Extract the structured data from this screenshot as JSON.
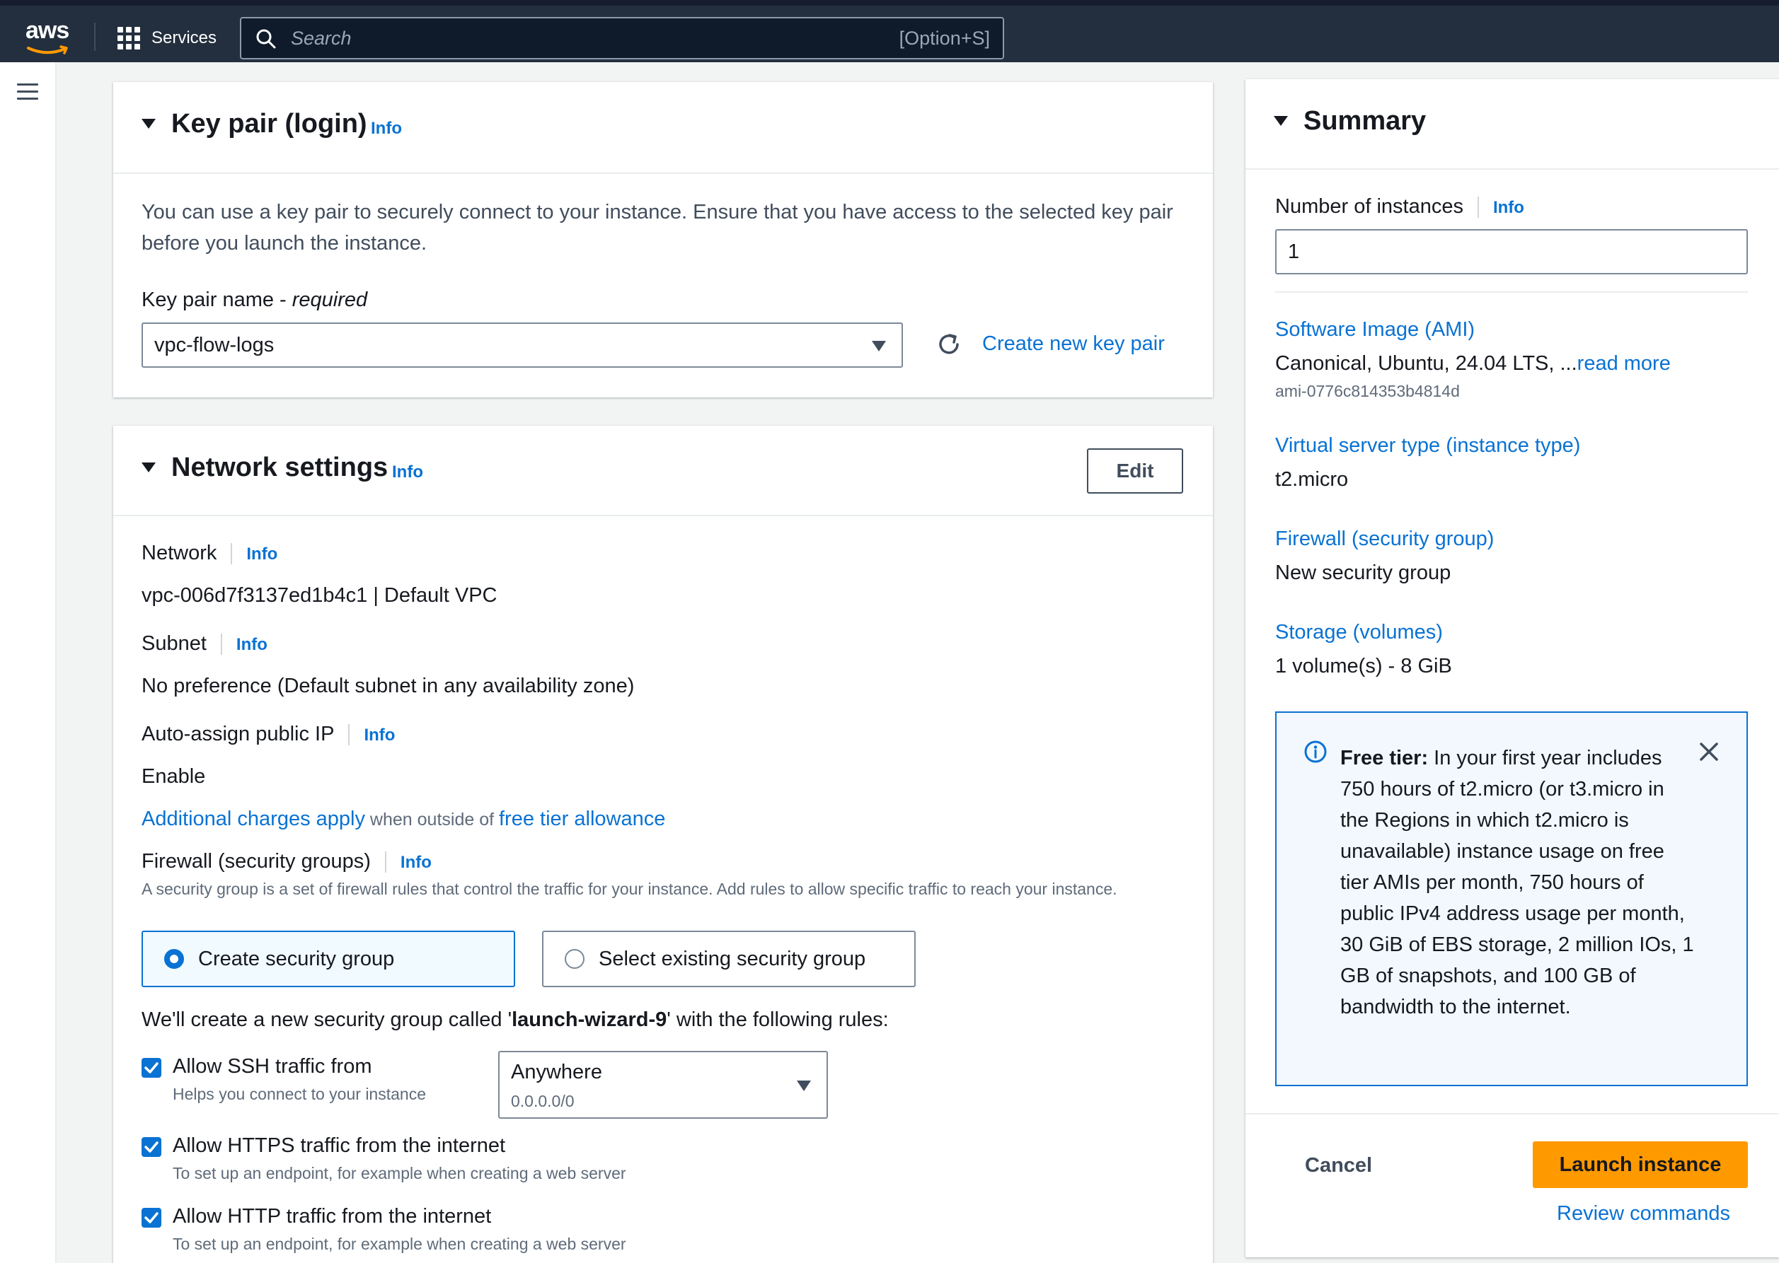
{
  "topbar": {
    "logo_text": "aws",
    "services_label": "Services",
    "search_placeholder": "Search",
    "search_shortcut": "[Option+S]"
  },
  "key_pair": {
    "title": "Key pair (login)",
    "info": "Info",
    "description": "You can use a key pair to securely connect to your instance. Ensure that you have access to the selected key pair before you launch the instance.",
    "field_label": "Key pair name - ",
    "field_required": "required",
    "selected_value": "vpc-flow-logs",
    "create_link": "Create new key pair"
  },
  "network": {
    "title": "Network settings",
    "info": "Info",
    "edit_label": "Edit",
    "network_label": "Network",
    "network_value": "vpc-006d7f3137ed1b4c1 | Default VPC",
    "subnet_label": "Subnet",
    "subnet_value": "No preference (Default subnet in any availability zone)",
    "public_ip_label": "Auto-assign public IP",
    "public_ip_value": "Enable",
    "charges_link": "Additional charges apply",
    "charges_mid": " when outside of ",
    "free_tier_link": "free tier allowance",
    "firewall_label": "Firewall (security groups)",
    "firewall_desc": "A security group is a set of firewall rules that control the traffic for your instance. Add rules to allow specific traffic to reach your instance.",
    "option_create": "Create security group",
    "option_select": "Select existing security group",
    "sg_text_pre": "We'll create a new security group called '",
    "sg_name": "launch-wizard-9",
    "sg_text_post": "' with the following rules:",
    "rules": [
      {
        "label": "Allow SSH traffic from",
        "help": "Helps you connect to your instance",
        "checked": true
      },
      {
        "label": "Allow HTTPS traffic from the internet",
        "help": "To set up an endpoint, for example when creating a web server",
        "checked": true
      },
      {
        "label": "Allow HTTP traffic from the internet",
        "help": "To set up an endpoint, for example when creating a web server",
        "checked": true
      }
    ],
    "ssh_source_value": "Anywhere",
    "ssh_source_sub": "0.0.0.0/0"
  },
  "summary": {
    "title": "Summary",
    "instances_label": "Number of instances",
    "info": "Info",
    "instances_value": "1",
    "ami_label": "Software Image (AMI)",
    "ami_value": "Canonical, Ubuntu, 24.04 LTS, ...",
    "ami_read_more": "read more",
    "ami_id": "ami-0776c814353b4814d",
    "type_label": "Virtual server type (instance type)",
    "type_value": "t2.micro",
    "firewall_label": "Firewall (security group)",
    "firewall_value": "New security group",
    "storage_label": "Storage (volumes)",
    "storage_value": "1 volume(s) - 8 GiB",
    "free_tier_bold": "Free tier:",
    "free_tier_text": " In your first year includes 750 hours of t2.micro (or t3.micro in the Regions in which t2.micro is unavailable) instance usage on free tier AMIs per month, 750 hours of public IPv4 address usage per month, 30 GiB of EBS storage, 2 million IOs, 1 GB of snapshots, and 100 GB of bandwidth to the internet.",
    "cancel_label": "Cancel",
    "launch_label": "Launch instance",
    "review_label": "Review commands"
  },
  "colors": {
    "nav_bg": "#232f3e",
    "link": "#0972d3",
    "launch": "#ff9900"
  }
}
